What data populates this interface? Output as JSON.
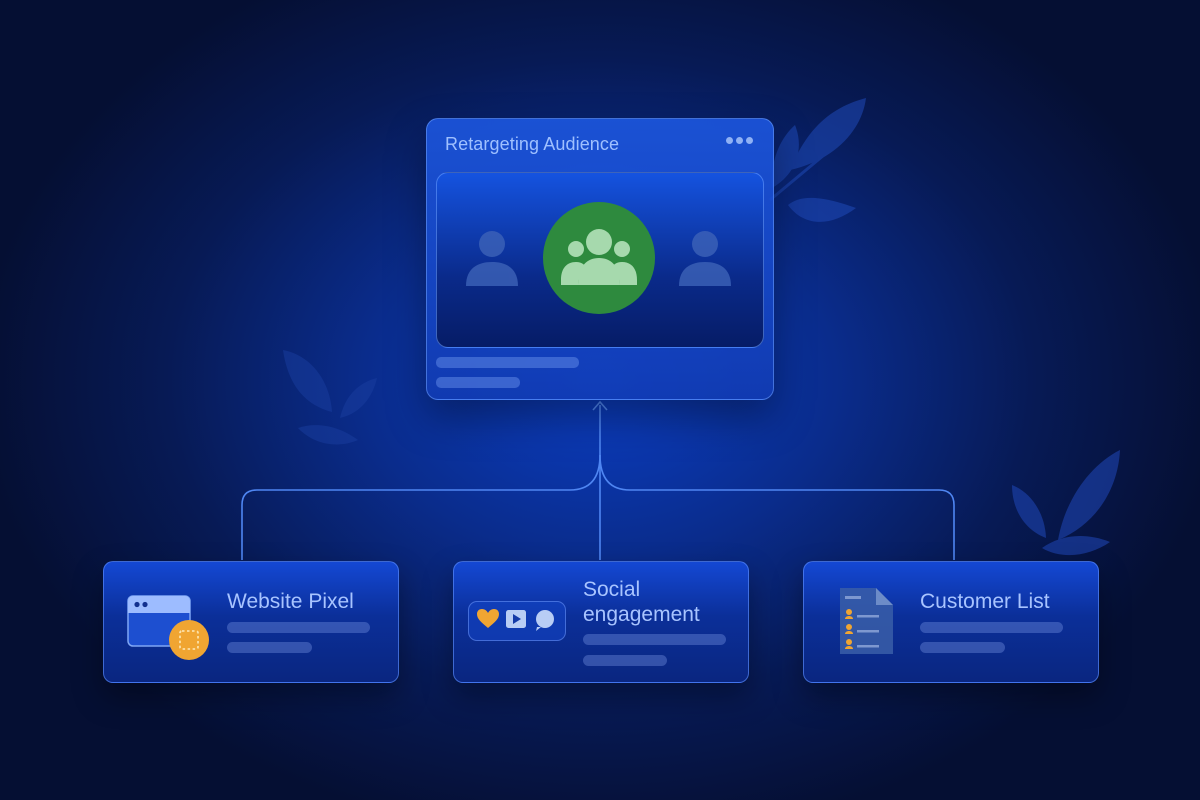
{
  "main_card": {
    "title": "Retargeting Audience",
    "menu_icon": "more-horizontal-icon",
    "center_icon": "group-icon",
    "center_color": "#2e8a3e",
    "side_icons": [
      "person-icon",
      "person-icon"
    ]
  },
  "sources": [
    {
      "title": "Website Pixel",
      "icon": "browser-window-icon"
    },
    {
      "title_line1": "Social",
      "title_line2": "engagement",
      "icons": [
        "heart-icon",
        "play-icon",
        "chat-bubble-icon"
      ]
    },
    {
      "title": "Customer List",
      "icon": "document-list-icon"
    }
  ],
  "colors": {
    "accent_green": "#2e8a3e",
    "accent_orange": "#f0a532",
    "connector": "#4f86f2"
  }
}
